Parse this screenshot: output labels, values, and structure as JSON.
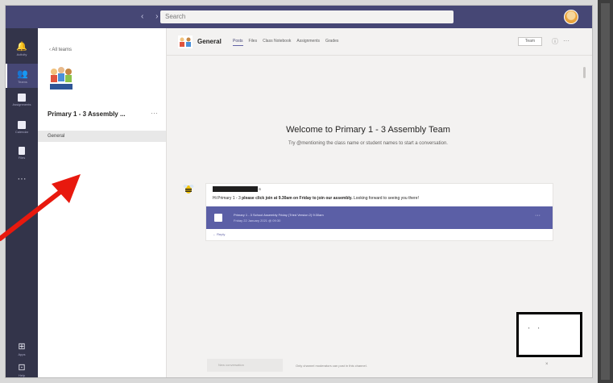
{
  "topbar": {
    "nav_arrows": "‹ ›",
    "search_placeholder": "Search",
    "avatar": "user-avatar"
  },
  "rail": {
    "items": [
      {
        "label": "Activity",
        "icon": "bell-icon"
      },
      {
        "label": "Teams",
        "icon": "teams-icon"
      },
      {
        "label": "Assignments",
        "icon": "assignment-icon"
      },
      {
        "label": "Calendar",
        "icon": "calendar-icon"
      },
      {
        "label": "Files",
        "icon": "file-icon"
      },
      {
        "label": "More",
        "icon": "more-icon"
      },
      {
        "label": "Apps",
        "icon": "apps-icon"
      },
      {
        "label": "Help",
        "icon": "help-icon"
      }
    ]
  },
  "teams_panel": {
    "back_label": "All teams",
    "team_name": "Primary 1 - 3 Assembly ...",
    "more": "···",
    "channels": [
      "General"
    ]
  },
  "main": {
    "channel_title": "General",
    "tabs": [
      "Posts",
      "Files",
      "Class Notebook",
      "Assignments",
      "Grades"
    ],
    "team_button": "Team",
    "welcome_title": "Welcome to Primary 1 - 3 Assembly Team",
    "welcome_sub": "Try @mentioning the class name or student names to start a conversation.",
    "post": {
      "author_suffix": "a",
      "text_before": "Hi Primary 1 - 3 ",
      "text_bold": "please click join at 9.30am on Friday to join our assembly.",
      "text_after": " Looking forward to seeing you there!",
      "meeting_title": "Primary 1 - 3 School Assembly Friday (Tried Version 2) 9:30am",
      "meeting_time": "Friday 22 January 2021 @ 09:30",
      "meeting_more": "···",
      "reply": "← Reply"
    },
    "compose": {
      "button": "New conversation",
      "note": "Only channel moderators can post in this channel.",
      "close": "×"
    }
  },
  "colors": {
    "topbar": "#464775",
    "rail": "#33344a",
    "meeting_card": "#5b5fa6",
    "annotation_arrow": "#e8190e"
  }
}
